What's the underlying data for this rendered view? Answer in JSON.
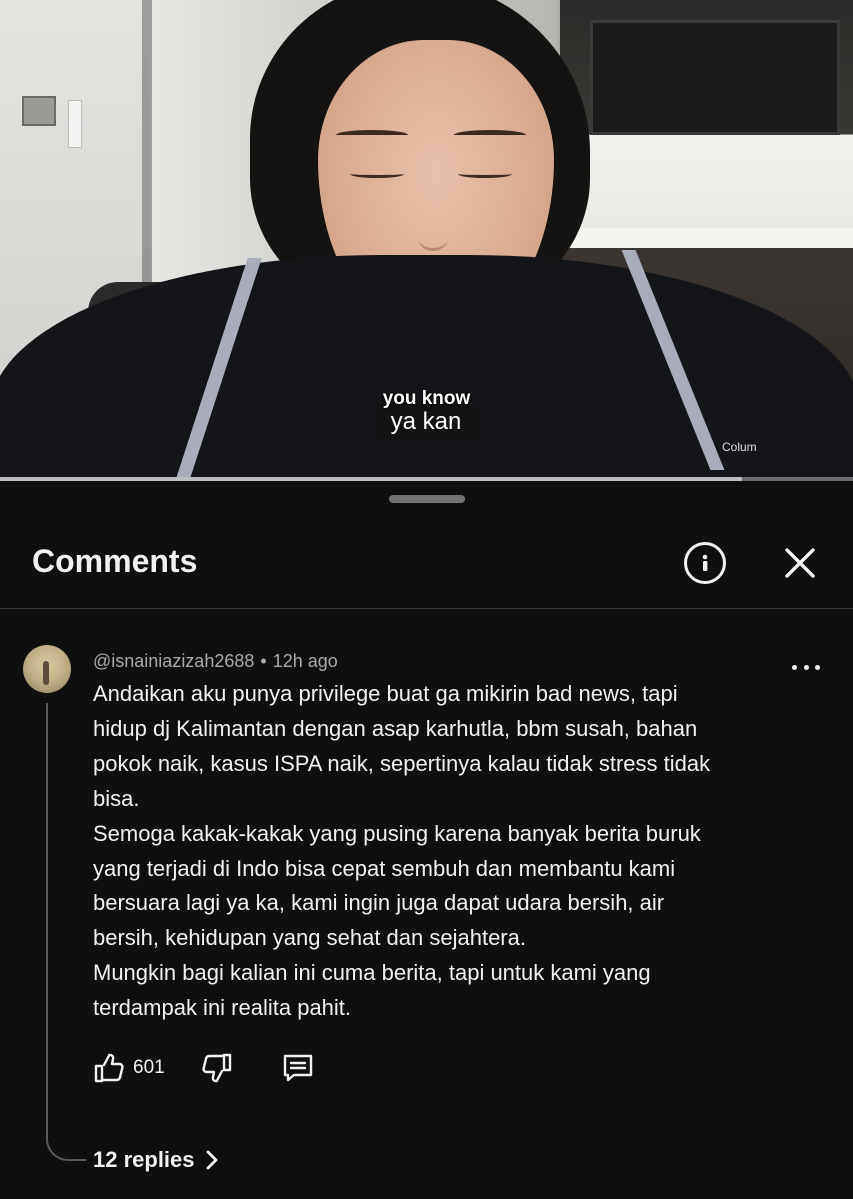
{
  "video": {
    "caption_top": "you know",
    "caption_main": "ya kan",
    "progress": 0.87,
    "jacket_logo": "Colum"
  },
  "sheet": {
    "title": "Comments",
    "info_icon": "info-icon",
    "close_icon": "close-icon"
  },
  "comment": {
    "author": "@isnainiazizah2688",
    "time": "12h ago",
    "text": "Andaikan aku punya privilege buat ga mikirin bad news, tapi\nhidup dj Kalimantan dengan asap karhutla, bbm susah, bahan\npokok naik, kasus ISPA naik, sepertinya kalau tidak stress tidak\nbisa.\nSemoga kakak-kakak yang pusing karena banyak berita buruk\nyang terjadi di Indo bisa cepat sembuh dan membantu kami\nbersuara lagi ya ka, kami ingin juga dapat udara bersih, air\nbersih, kehidupan yang sehat dan sejahtera.\nMungkin bagi kalian ini cuma berita, tapi untuk kami yang\nterdampak ini realita pahit.",
    "likes": "601",
    "replies_label": "12 replies"
  },
  "colors": {
    "background": "#0f0f0f",
    "text_primary": "#f1f1f1",
    "text_secondary": "#aaaaaa",
    "divider": "#3a3a3a"
  }
}
